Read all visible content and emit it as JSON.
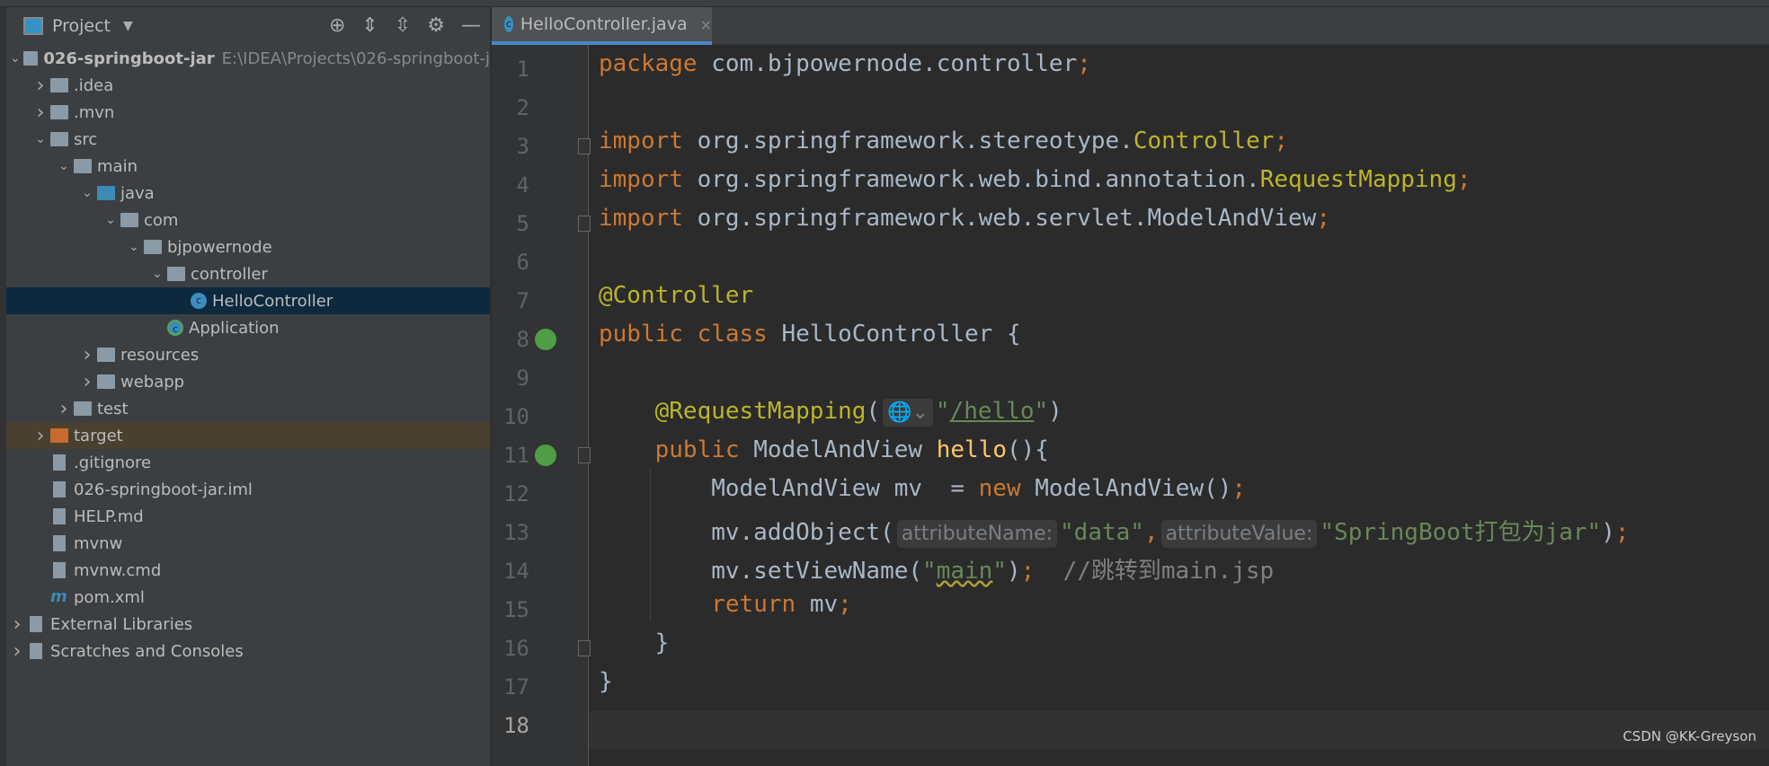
{
  "panel": {
    "title": "Project",
    "tools": [
      "locate-icon",
      "expand-all-icon",
      "collapse-all-icon",
      "gear-icon",
      "minimize-icon"
    ]
  },
  "tree": [
    {
      "label": "026-springboot-jar",
      "path": "E:\\IDEA\\Projects\\026-springboot-j",
      "depth": 0,
      "arrow": "open",
      "icon": "module",
      "bold": true
    },
    {
      "label": ".idea",
      "depth": 1,
      "arrow": "closed",
      "icon": "folder"
    },
    {
      "label": ".mvn",
      "depth": 1,
      "arrow": "closed",
      "icon": "folder"
    },
    {
      "label": "src",
      "depth": 1,
      "arrow": "open",
      "icon": "folder"
    },
    {
      "label": "main",
      "depth": 2,
      "arrow": "open",
      "icon": "folder"
    },
    {
      "label": "java",
      "depth": 3,
      "arrow": "open",
      "icon": "folder-blue"
    },
    {
      "label": "com",
      "depth": 4,
      "arrow": "open",
      "icon": "package"
    },
    {
      "label": "bjpowernode",
      "depth": 5,
      "arrow": "open",
      "icon": "package"
    },
    {
      "label": "controller",
      "depth": 6,
      "arrow": "open",
      "icon": "package"
    },
    {
      "label": "HelloController",
      "depth": 7,
      "arrow": "",
      "icon": "class",
      "selected": true
    },
    {
      "label": "Application",
      "depth": 6,
      "arrow": "",
      "icon": "spring-class"
    },
    {
      "label": "resources",
      "depth": 3,
      "arrow": "closed",
      "icon": "folder"
    },
    {
      "label": "webapp",
      "depth": 3,
      "arrow": "closed",
      "icon": "folder"
    },
    {
      "label": "test",
      "depth": 2,
      "arrow": "closed",
      "icon": "folder"
    },
    {
      "label": "target",
      "depth": 1,
      "arrow": "closed",
      "icon": "folder-orange",
      "highlight": true
    },
    {
      "label": ".gitignore",
      "depth": 1,
      "arrow": "",
      "icon": "file"
    },
    {
      "label": "026-springboot-jar.iml",
      "depth": 1,
      "arrow": "",
      "icon": "file"
    },
    {
      "label": "HELP.md",
      "depth": 1,
      "arrow": "",
      "icon": "file"
    },
    {
      "label": "mvnw",
      "depth": 1,
      "arrow": "",
      "icon": "file"
    },
    {
      "label": "mvnw.cmd",
      "depth": 1,
      "arrow": "",
      "icon": "file"
    },
    {
      "label": "pom.xml",
      "depth": 1,
      "arrow": "",
      "icon": "maven"
    },
    {
      "label": "External Libraries",
      "depth": 0,
      "arrow": "closed",
      "icon": "library"
    },
    {
      "label": "Scratches and Consoles",
      "depth": 0,
      "arrow": "closed",
      "icon": "scratches"
    }
  ],
  "tab": {
    "label": "HelloController.java",
    "close": "×"
  },
  "code": [
    [
      [
        "kw",
        "package "
      ],
      [
        "",
        "com.bjpowernode.controller"
      ],
      [
        "kw",
        ";"
      ]
    ],
    [],
    [
      [
        "kw",
        "import "
      ],
      [
        "",
        "org.springframework.stereotype."
      ],
      [
        "an",
        "Controller"
      ],
      [
        "kw",
        ";"
      ]
    ],
    [
      [
        "kw",
        "import "
      ],
      [
        "",
        "org.springframework.web.bind.annotation."
      ],
      [
        "an",
        "RequestMapping"
      ],
      [
        "kw",
        ";"
      ]
    ],
    [
      [
        "kw",
        "import "
      ],
      [
        "",
        "org.springframework.web.servlet.ModelAndView"
      ],
      [
        "kw",
        ";"
      ]
    ],
    [],
    [
      [
        "an",
        "@Controller"
      ]
    ],
    [
      [
        "kw",
        "public class "
      ],
      [
        "",
        "HelloController {"
      ]
    ],
    [],
    [
      [
        "",
        "    "
      ],
      [
        "an",
        "@RequestMapping"
      ],
      [
        "",
        "("
      ],
      [
        "hint",
        "🌐⌄"
      ],
      [
        "st",
        "\""
      ],
      [
        "st ul",
        "/hello"
      ],
      [
        "st",
        "\""
      ],
      [
        "",
        ")"
      ]
    ],
    [
      [
        "",
        "    "
      ],
      [
        "kw",
        "public "
      ],
      [
        "",
        "ModelAndView "
      ],
      [
        "fn",
        "hello"
      ],
      [
        "",
        "(){"
      ]
    ],
    [
      [
        "",
        "        ModelAndView mv  = "
      ],
      [
        "kw",
        "new "
      ],
      [
        "",
        "ModelAndView()"
      ],
      [
        "kw",
        ";"
      ]
    ],
    [
      [
        "",
        "        mv.addObject("
      ],
      [
        "hint",
        "attributeName:"
      ],
      [
        "st",
        "\"data\""
      ],
      [
        "kw",
        ","
      ],
      [
        "hint",
        "attributeValue:"
      ],
      [
        "st",
        "\"SpringBoot打包为jar\""
      ],
      [
        "",
        ")"
      ],
      [
        "kw",
        ";"
      ]
    ],
    [
      [
        "",
        "        mv.setViewName("
      ],
      [
        "st",
        "\""
      ],
      [
        "st wavy",
        "main"
      ],
      [
        "st",
        "\""
      ],
      [
        "",
        ")"
      ],
      [
        "kw",
        ";"
      ],
      [
        "cm",
        "  //跳转到main.jsp"
      ]
    ],
    [
      [
        "",
        "        "
      ],
      [
        "kw",
        "return "
      ],
      [
        "",
        "mv"
      ],
      [
        "kw",
        ";"
      ]
    ],
    [
      [
        "",
        "    }"
      ]
    ],
    [
      [
        "",
        "}"
      ]
    ],
    []
  ],
  "current_line": 18,
  "watermark": "CSDN @KK-Greyson"
}
